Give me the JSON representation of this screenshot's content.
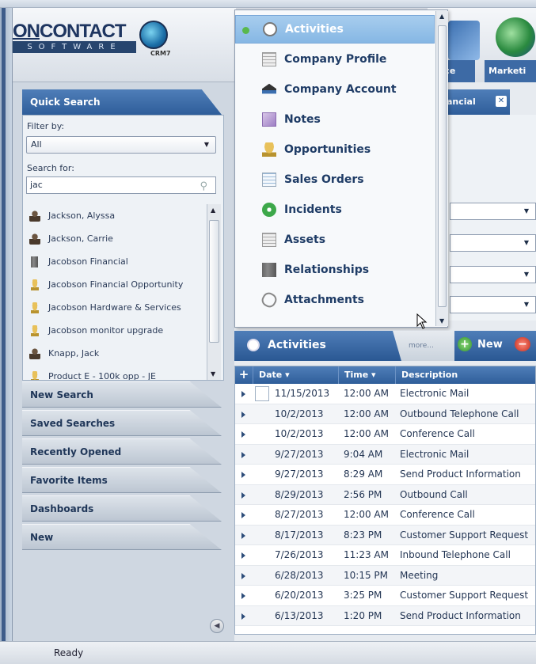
{
  "window": {
    "title": "OnContact CRM"
  },
  "logo": {
    "word_left": "ON",
    "word_right": "CONTACT",
    "sub": "SOFTWARE",
    "crm": "CRM7"
  },
  "quick_search": {
    "title": "Quick Search",
    "filter_label": "Filter by:",
    "filter_value": "All",
    "search_label": "Search for:",
    "search_value": "jac",
    "results": [
      {
        "icon": "person-icon",
        "label": "Jackson, Alyssa"
      },
      {
        "icon": "person-icon",
        "label": "Jackson, Carrie"
      },
      {
        "icon": "building-icon",
        "label": "Jacobson Financial"
      },
      {
        "icon": "trophy-icon",
        "label": "Jacobson Financial Opportunity"
      },
      {
        "icon": "trophy-icon",
        "label": "Jacobson Hardware & Services"
      },
      {
        "icon": "trophy-icon",
        "label": "Jacobson monitor upgrade"
      },
      {
        "icon": "person-icon",
        "label": "Knapp, Jack"
      },
      {
        "icon": "trophy-icon",
        "label": "Product E - 100k opp - JE"
      }
    ]
  },
  "nav": {
    "new_search": "New Search",
    "saved_searches": "Saved Searches",
    "recently_opened": "Recently Opened",
    "favorite_items": "Favorite Items",
    "dashboards": "Dashboards",
    "new": "New"
  },
  "top_tabs": {
    "workspace": "pace",
    "marketing": "Marketi"
  },
  "doc_tab": {
    "label": "ancial"
  },
  "menu": {
    "items": [
      {
        "icon": "clock-icon",
        "label": "Activities"
      },
      {
        "icon": "document-icon",
        "label": "Company Profile"
      },
      {
        "icon": "hat-icon",
        "label": "Company Account"
      },
      {
        "icon": "notes-icon",
        "label": "Notes"
      },
      {
        "icon": "trophy-icon",
        "label": "Opportunities"
      },
      {
        "icon": "orders-icon",
        "label": "Sales Orders"
      },
      {
        "icon": "incident-icon",
        "label": "Incidents"
      },
      {
        "icon": "assets-icon",
        "label": "Assets"
      },
      {
        "icon": "relationships-icon",
        "label": "Relationships"
      },
      {
        "icon": "paperclip-icon",
        "label": "Attachments"
      }
    ]
  },
  "activities": {
    "title": "Activities",
    "more": "more...",
    "new_label": "New",
    "columns": [
      "Date",
      "Time",
      "Description"
    ],
    "rows": [
      {
        "date": "11/15/2013",
        "time": "12:00 AM",
        "desc": "Electronic Mail"
      },
      {
        "date": "10/2/2013",
        "time": "12:00 AM",
        "desc": "Outbound Telephone Call"
      },
      {
        "date": "10/2/2013",
        "time": "12:00 AM",
        "desc": "Conference Call"
      },
      {
        "date": "9/27/2013",
        "time": "9:04 AM",
        "desc": "Electronic Mail"
      },
      {
        "date": "9/27/2013",
        "time": "8:29 AM",
        "desc": "Send Product Information"
      },
      {
        "date": "8/29/2013",
        "time": "2:56 PM",
        "desc": "Outbound Call"
      },
      {
        "date": "8/27/2013",
        "time": "12:00 AM",
        "desc": "Conference Call"
      },
      {
        "date": "8/17/2013",
        "time": "8:23 PM",
        "desc": "Customer Support Request"
      },
      {
        "date": "7/26/2013",
        "time": "11:23 AM",
        "desc": "Inbound Telephone Call"
      },
      {
        "date": "6/28/2013",
        "time": "10:15 PM",
        "desc": "Meeting"
      },
      {
        "date": "6/20/2013",
        "time": "3:25 PM",
        "desc": "Customer Support Request"
      },
      {
        "date": "6/13/2013",
        "time": "1:20 PM",
        "desc": "Send Product Information"
      }
    ]
  },
  "status": {
    "text": "Ready"
  },
  "colors": {
    "accent": "#2f5e9a",
    "selected": "#86b7e4",
    "success": "#3da84a",
    "danger": "#c22a1a"
  }
}
